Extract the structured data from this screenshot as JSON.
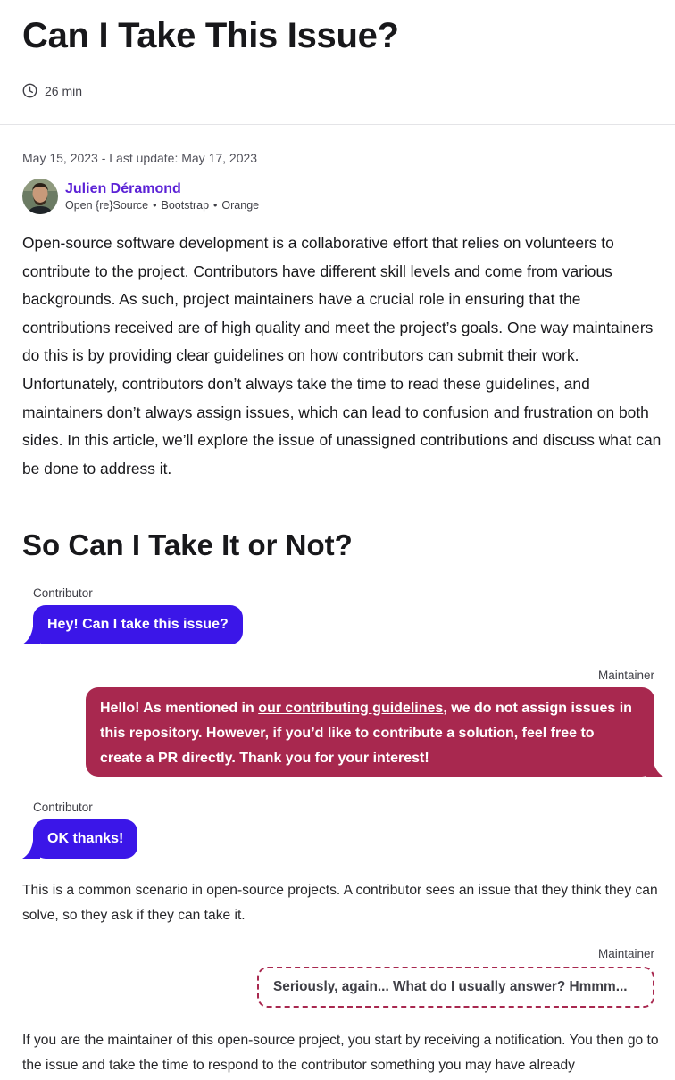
{
  "article": {
    "title": "Can I Take This Issue?",
    "reading_time": "26 min",
    "dates": "May 15, 2023 - Last update: May 17, 2023",
    "author": {
      "name": "Julien Déramond",
      "tags": [
        "Open {re}Source",
        "Bootstrap",
        "Orange"
      ]
    },
    "intro": "Open-source software development is a collaborative effort that relies on volunteers to contribute to the project. Contributors have different skill levels and come from various backgrounds. As such, project maintainers have a crucial role in ensuring that the contributions received are of high quality and meet the project’s goals. One way maintainers do this is by providing clear guidelines on how contributors can submit their work. Unfortunately, contributors don’t always take the time to read these guidelines, and maintainers don’t always assign issues, which can lead to confusion and frustration on both sides. In this article, we’ll explore the issue of unassigned contributions and discuss what can be done to address it.",
    "section_heading": "So Can I Take It or Not?"
  },
  "conversation": {
    "msg1": {
      "speaker": "Contributor",
      "text": "Hey! Can I take this issue?"
    },
    "msg2": {
      "speaker": "Maintainer",
      "before_link": "Hello! As mentioned in ",
      "link": "our contributing guidelines",
      "after_link": ", we do not assign issues in this repository. However, if you’d like to contribute a solution, feel free to create a PR directly. Thank you for your interest!"
    },
    "msg3": {
      "speaker": "Contributor",
      "text": "OK thanks!"
    },
    "thought": {
      "speaker": "Maintainer",
      "text": "Seriously, again... What do I usually answer? Hmmm..."
    }
  },
  "body": {
    "para1": "This is a common scenario in open-source projects. A contributor sees an issue that they think they can solve, so they ask if they can take it.",
    "para2": "If you are the maintainer of this open-source project, you start by receiving a notification. You then go to the issue and take the time to respond to the contributor something you may have already"
  },
  "colors": {
    "contributor_bubble": "#3b16e8",
    "maintainer_bubble": "#a8284f",
    "author_link": "#5b21d6"
  }
}
